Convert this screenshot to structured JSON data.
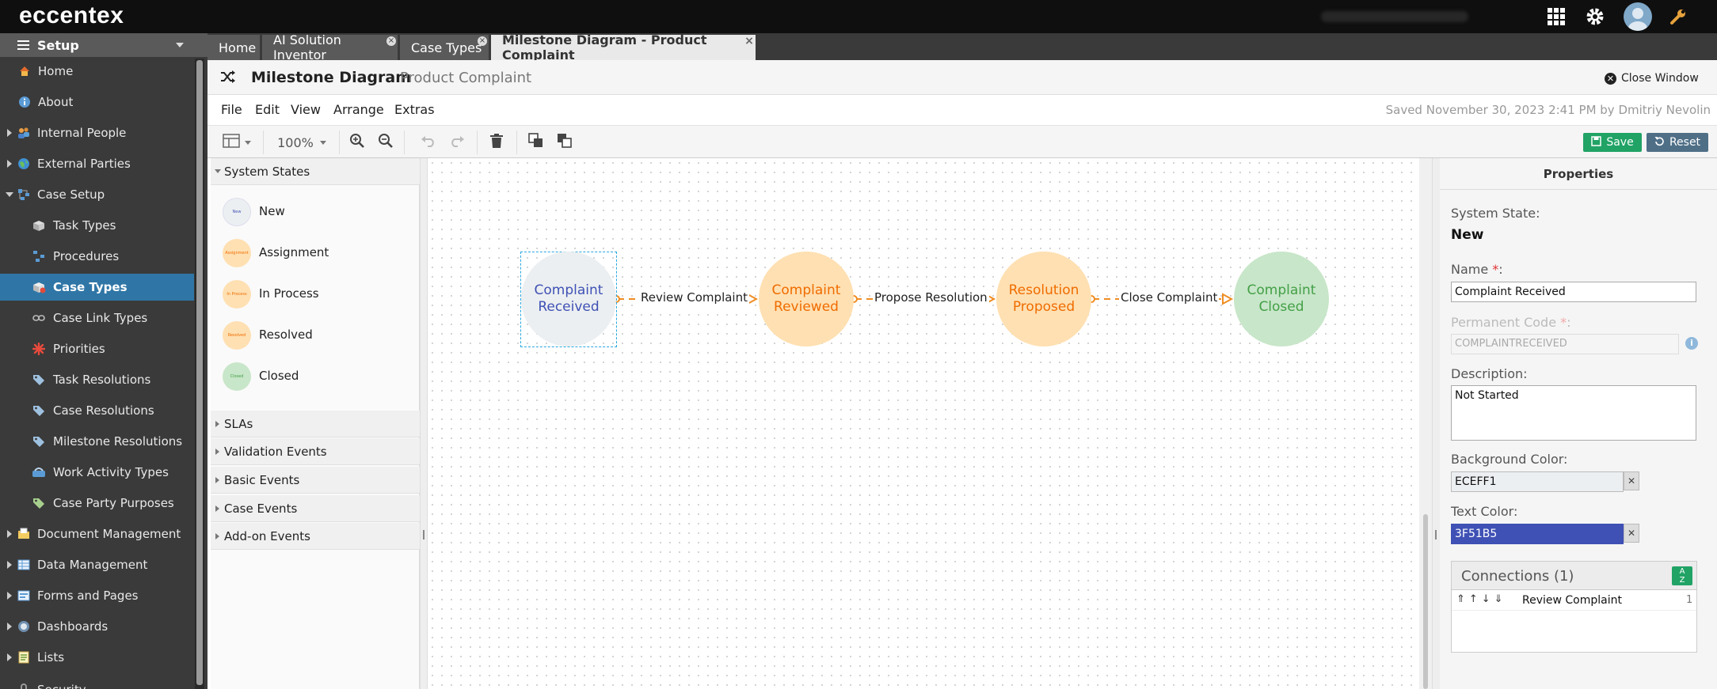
{
  "app": {
    "logo": "eccentex"
  },
  "colors": {
    "accent": "#2f76a6",
    "edge": "#f08c22",
    "save": "#21a366"
  },
  "sidebar": {
    "header": "Setup",
    "items": [
      {
        "label": "Home",
        "icon": "home-icon"
      },
      {
        "label": "About",
        "icon": "info-icon"
      },
      {
        "label": "Internal People",
        "icon": "people-icon"
      },
      {
        "label": "External Parties",
        "icon": "globe-icon"
      },
      {
        "label": "Case Setup",
        "icon": "case-setup-icon"
      },
      {
        "label": "Task Types",
        "icon": "task-types-icon"
      },
      {
        "label": "Procedures",
        "icon": "procedures-icon"
      },
      {
        "label": "Case Types",
        "icon": "case-types-icon"
      },
      {
        "label": "Case Link Types",
        "icon": "link-icon"
      },
      {
        "label": "Priorities",
        "icon": "priority-icon"
      },
      {
        "label": "Task Resolutions",
        "icon": "tag-icon"
      },
      {
        "label": "Case Resolutions",
        "icon": "tag-icon"
      },
      {
        "label": "Milestone Resolutions",
        "icon": "tag-icon"
      },
      {
        "label": "Work Activity Types",
        "icon": "work-activity-icon"
      },
      {
        "label": "Case Party Purposes",
        "icon": "tag-icon"
      },
      {
        "label": "Document Management",
        "icon": "folder-icon"
      },
      {
        "label": "Data Management",
        "icon": "table-icon"
      },
      {
        "label": "Forms and Pages",
        "icon": "form-icon"
      },
      {
        "label": "Dashboards",
        "icon": "dashboard-icon"
      },
      {
        "label": "Lists",
        "icon": "list-icon"
      },
      {
        "label": "Security",
        "icon": "security-icon"
      }
    ]
  },
  "tabs": [
    {
      "label": "Home"
    },
    {
      "label": "AI Solution Inventor"
    },
    {
      "label": "Case Types"
    },
    {
      "label": "Milestone Diagram - Product Complaint"
    }
  ],
  "title": {
    "main": "Milestone Diagram",
    "sub": "Product Complaint",
    "close": "Close Window"
  },
  "menu": [
    "File",
    "Edit",
    "View",
    "Arrange",
    "Extras"
  ],
  "saved_text": "Saved November 30, 2023 2:41 PM by Dmitriy Nevolin",
  "toolbar": {
    "zoom": "100%",
    "save": "Save",
    "reset": "Reset"
  },
  "palette": {
    "system_states_title": "System States",
    "states": [
      {
        "label": "New",
        "bg": "#eceff1",
        "fg": "#3f51b5"
      },
      {
        "label": "Assignment",
        "bg": "#ffe0b2",
        "fg": "#ef6c00"
      },
      {
        "label": "In Process",
        "bg": "#ffe0b2",
        "fg": "#ef6c00"
      },
      {
        "label": "Resolved",
        "bg": "#ffe0b2",
        "fg": "#ef6c00"
      },
      {
        "label": "Closed",
        "bg": "#c8e6c9",
        "fg": "#43a047"
      }
    ],
    "sections": [
      "SLAs",
      "Validation Events",
      "Basic Events",
      "Case Events",
      "Add-on Events"
    ]
  },
  "diagram": {
    "nodes": [
      {
        "line1": "Complaint",
        "line2": "Received"
      },
      {
        "line1": "Complaint",
        "line2": "Reviewed"
      },
      {
        "line1": "Resolution",
        "line2": "Proposed"
      },
      {
        "line1": "Complaint",
        "line2": "Closed"
      }
    ],
    "edges": [
      "Review Complaint",
      "Propose Resolution",
      "Close Complaint"
    ]
  },
  "properties": {
    "title": "Properties",
    "system_state_label": "System State:",
    "system_state_value": "New",
    "name_label": "Name",
    "name_value": "Complaint Received",
    "code_label": "Permanent Code",
    "code_value": "COMPLAINTRECEIVED",
    "description_label": "Description:",
    "description_value": "Not Started",
    "bg_label": "Background Color:",
    "bg_value": "ECEFF1",
    "text_label": "Text Color:",
    "text_value": "3F51B5",
    "connections_title": "Connections (1)",
    "connection_name": "Review Complaint",
    "connection_order": "1"
  }
}
